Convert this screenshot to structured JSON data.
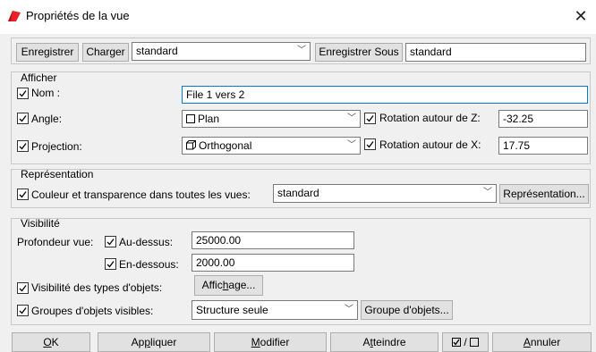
{
  "window": {
    "title": "Propriétés de la vue",
    "close_label": "✕"
  },
  "toolbar": {
    "save_label": "Enregistrer",
    "load_label": "Charger",
    "preset_value": "standard",
    "save_as_label": "Enregistrer Sous",
    "save_as_value": "standard"
  },
  "afficher": {
    "title": "Afficher",
    "name_label": "Nom :",
    "name_value": "File 1 vers 2",
    "angle_label": "Angle:",
    "angle_value": "Plan",
    "rotation_z_label": "Rotation autour de Z:",
    "rotation_z_value": "-32.25",
    "projection_label": "Projection:",
    "projection_value": "Orthogonal",
    "rotation_x_label": "Rotation autour de X:",
    "rotation_x_value": "17.75"
  },
  "representation": {
    "title": "Représentation",
    "color_label": "Couleur et transparence dans toutes les vues:",
    "color_value": "standard",
    "button_label": "Représentation..."
  },
  "visibilite": {
    "title": "Visibilité",
    "depth_label": "Profondeur vue:",
    "above_label": "Au-dessus:",
    "above_value": "25000.00",
    "below_label": "En-dessous:",
    "below_value": "2000.00",
    "types_label": "Visibilité des types d'objets:",
    "display_button": {
      "pre": "Affic",
      "ul": "h",
      "post": "age..."
    },
    "groups_label": "Groupes d'objets visibles:",
    "groups_value": "Structure seule",
    "groups_button": "Groupe d'objets..."
  },
  "footer": {
    "ok": {
      "ul": "O",
      "post": "K"
    },
    "apply": {
      "pre": "Ap",
      "ul": "p",
      "post": "liquer"
    },
    "modify": {
      "ul": "M",
      "post": "odifier"
    },
    "reach": {
      "pre": "A",
      "ul": "t",
      "post": "teindre"
    },
    "toggle_label": "/",
    "cancel": {
      "ul": "A",
      "post": "nnuler"
    }
  }
}
